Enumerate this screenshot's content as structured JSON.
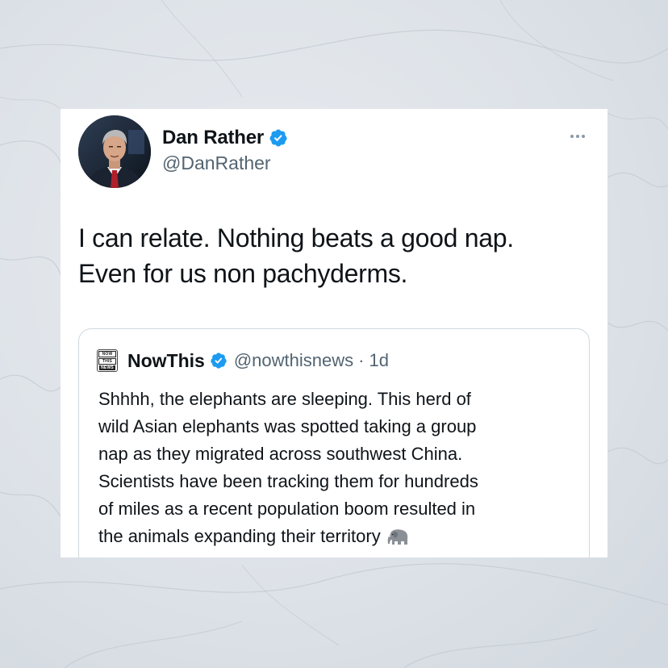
{
  "tweet": {
    "author_name": "Dan Rather",
    "author_handle": "@DanRather",
    "text_lines": [
      "I can relate. Nothing beats a good nap.",
      "Even for us non pachyderms."
    ]
  },
  "quoted_tweet": {
    "author_name": "NowThis",
    "author_handle": "@nowthisnews",
    "separator": "·",
    "time": "1d",
    "logo_lines": [
      "NOW",
      "THIS",
      "NEWS"
    ],
    "text_lines": [
      "Shhhh, the elephants are sleeping. This herd of",
      "wild Asian elephants was spotted taking a group",
      "nap as they migrated across southwest China.",
      "Scientists have been tracking them for hundreds",
      "of miles as a recent population boom resulted in",
      "the animals expanding their territory"
    ]
  },
  "icons": {
    "verified": "verified-badge-icon",
    "more": "more-options-icon",
    "emoji": "elephant-emoji-icon"
  },
  "colors": {
    "verified_blue": "#1d9bf0",
    "text_primary": "#0f1419",
    "text_secondary": "#536471",
    "background_marble": "#dfe3e8"
  }
}
